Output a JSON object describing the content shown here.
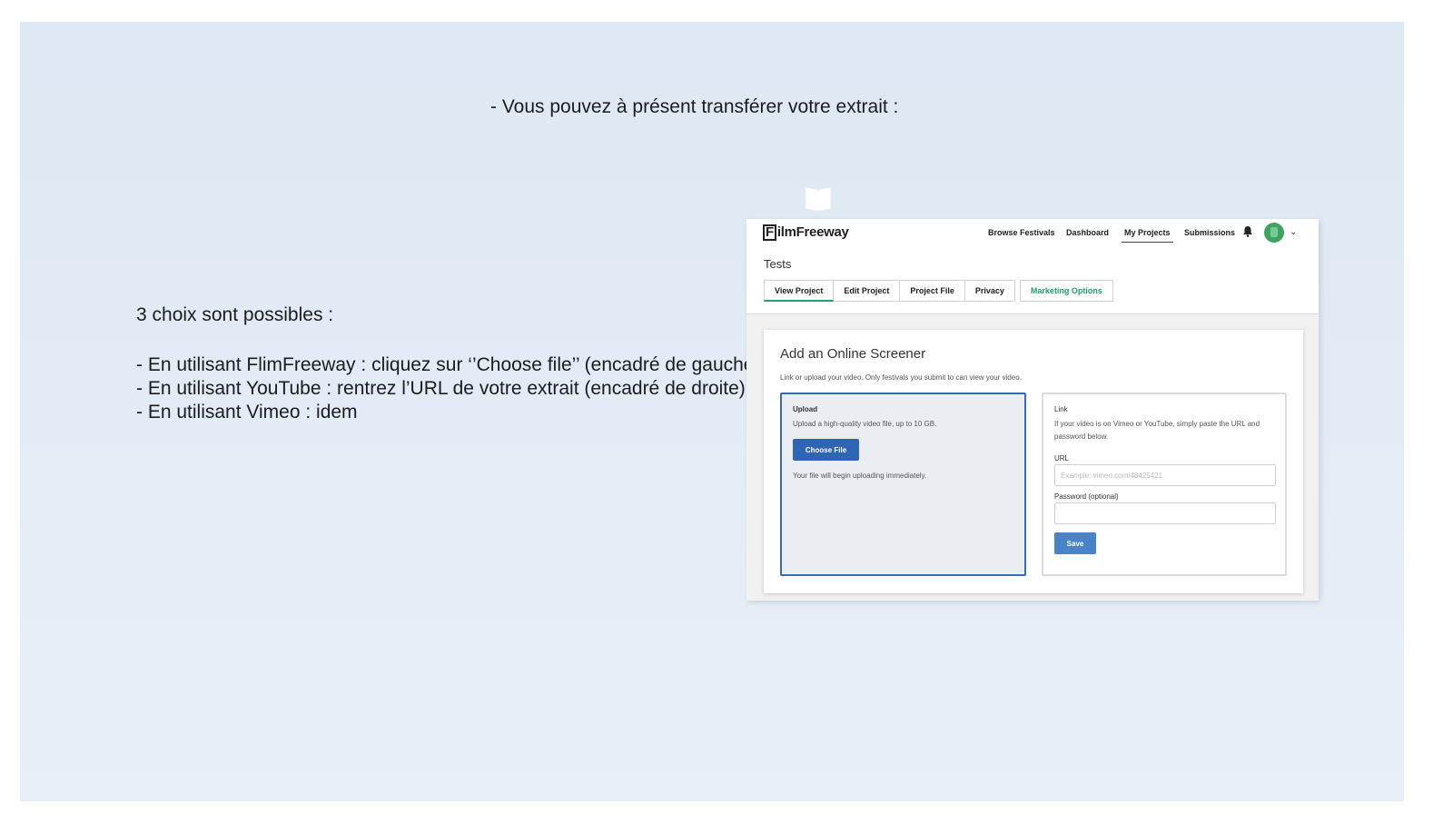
{
  "slide": {
    "heading": "- Vous pouvez à présent transférer votre extrait :",
    "intro": "3 choix sont possibles :",
    "choices": [
      "- En utilisant FlimFreeway : cliquez sur ‘’Choose file’’ (encadré de gauche)",
      "- En utilisant YouTube :  rentrez l’URL de votre extrait (encadré de droite)",
      "- En utilisant Vimeo : idem"
    ]
  },
  "screenshot": {
    "logo_first": "F",
    "logo_rest": "ilmFreeway",
    "nav": [
      "Browse Festivals",
      "Dashboard",
      "My Projects",
      "Submissions"
    ],
    "icons": {
      "notifications": "bell-icon",
      "avatar": "user-avatar",
      "menu": "chevron-down-icon",
      "document": "document-icon"
    },
    "chevron": "⌄",
    "project_title": "Tests",
    "tabs": [
      "View Project",
      "Edit Project",
      "Project File",
      "Privacy",
      "Marketing Options"
    ],
    "card": {
      "title": "Add an Online Screener",
      "subtitle": "Link or upload your video. Only festivals you submit to can view your video.",
      "upload": {
        "heading": "Upload",
        "description": "Upload a high-quality video file, up to 10 GB.",
        "button": "Choose File",
        "note": "Your file will begin uploading immediately."
      },
      "link": {
        "heading": "Link",
        "description": "If your video is on Vimeo or YouTube, simply paste the URL and password below.",
        "url_label": "URL",
        "url_placeholder": "Example: vimeo.com/48425421",
        "password_label": "Password (optional)",
        "password_value": "",
        "button": "Save"
      }
    },
    "colors": {
      "accent_green": "#23a06a",
      "primary_blue": "#2e66b5",
      "save_blue": "#4a83c8"
    }
  }
}
